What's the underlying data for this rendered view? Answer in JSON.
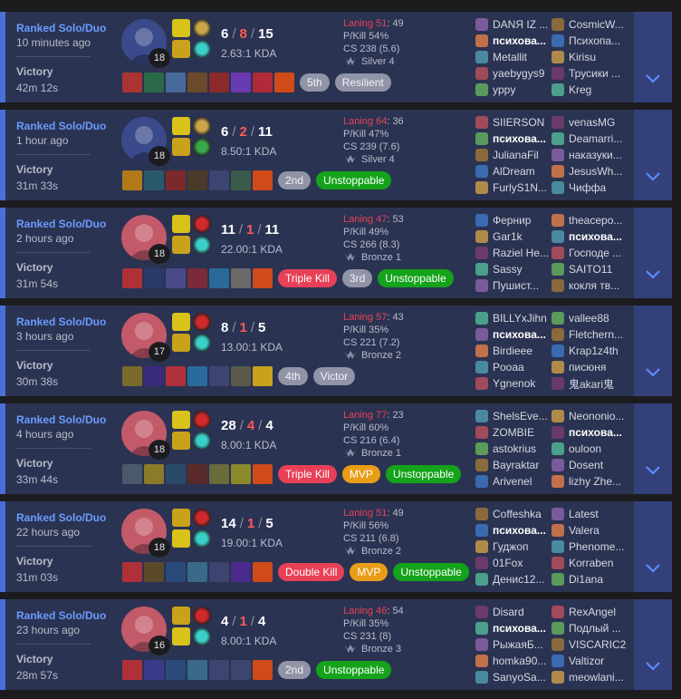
{
  "matches": [
    {
      "queue": "Ranked Solo/Duo",
      "time_ago": "10 minutes ago",
      "result": "Victory",
      "duration": "42m 12s",
      "champion_icon": "warwick-champion-icon",
      "champ_color": "#3a4a8a",
      "level": "18",
      "spells": [
        "flash-spell-icon",
        "smite-spell-icon"
      ],
      "spell_colors": [
        "#d9c21a",
        "#c8a21a"
      ],
      "runes": [
        "conqueror-rune-icon",
        "sorcery-rune-icon"
      ],
      "rune_colors": [
        "#c9a64a",
        "#3ad0c8"
      ],
      "kills": "6",
      "deaths": "8",
      "assists": "15",
      "kda_ratio": "2.63:1 KDA",
      "item_colors": [
        "#a33",
        "#2a6a4a",
        "#486a9a",
        "#6a4a2a",
        "#8a2a2a",
        "#6a3ab0",
        "#b02a3a",
        "#d04a1a"
      ],
      "badges": [
        {
          "text": "5th",
          "style": "place"
        },
        {
          "text": "Resilient",
          "style": "grey"
        }
      ],
      "laning_label": "Laning 51",
      "laning_opp": ": 49",
      "pkill": "P/Kill 54%",
      "cs": "CS 238 (5.6)",
      "rank": "Silver 4",
      "blue_team": [
        "DANЯ IZ ...",
        "психова...",
        "Metallit",
        "yaebygys9",
        "yppy"
      ],
      "red_team": [
        "CosmicW...",
        "Психопа...",
        "Kirisu",
        "Трусики ...",
        "Kreg"
      ],
      "me_index": 1
    },
    {
      "queue": "Ranked Solo/Duo",
      "time_ago": "1 hour ago",
      "result": "Victory",
      "duration": "31m 33s",
      "champion_icon": "warwick-champion-icon",
      "champ_color": "#3a4a8a",
      "level": "18",
      "spells": [
        "flash-spell-icon",
        "smite-spell-icon"
      ],
      "spell_colors": [
        "#d9c21a",
        "#c8a21a"
      ],
      "runes": [
        "conqueror-rune-icon",
        "resolve-rune-icon"
      ],
      "rune_colors": [
        "#c9a64a",
        "#3aa84a"
      ],
      "kills": "6",
      "deaths": "2",
      "assists": "11",
      "kda_ratio": "8.50:1 KDA",
      "item_colors": [
        "#b07a1a",
        "#2a5a6a",
        "#7a2a2a",
        "#4a3a2a",
        "empty",
        "#3a5a4a",
        "#d04a1a"
      ],
      "badges": [
        {
          "text": "2nd",
          "style": "place"
        },
        {
          "text": "Unstoppable",
          "style": "green"
        }
      ],
      "laning_label": "Laning 64",
      "laning_opp": ": 36",
      "pkill": "P/Kill 47%",
      "cs": "CS 239 (7.6)",
      "rank": "Silver 4",
      "blue_team": [
        "SIIERSON",
        "психова...",
        "JulianaFil",
        "AlDream",
        "FurlyS1N..."
      ],
      "red_team": [
        "venasMG",
        "Deamarri...",
        "наказуки...",
        "JesusWh...",
        "Чиффа"
      ],
      "me_index": 1
    },
    {
      "queue": "Ranked Solo/Duo",
      "time_ago": "2 hours ago",
      "result": "Victory",
      "duration": "31m 54s",
      "champion_icon": "vi-champion-icon",
      "champ_color": "#c25a6a",
      "level": "18",
      "spells": [
        "flash-spell-icon",
        "smite-spell-icon"
      ],
      "spell_colors": [
        "#d9c21a",
        "#c8a21a"
      ],
      "runes": [
        "electrocute-rune-icon",
        "sorcery-rune-icon"
      ],
      "rune_colors": [
        "#d02a2a",
        "#3ad0c8"
      ],
      "kills": "11",
      "deaths": "1",
      "assists": "11",
      "kda_ratio": "22.00:1 KDA",
      "item_colors": [
        "#b0303a",
        "#2a3a6a",
        "#4a4a8a",
        "#7a2a3a",
        "#2a6a9a",
        "#6a6a6a",
        "#d04a1a"
      ],
      "badges": [
        {
          "text": "Triple Kill",
          "style": "red"
        },
        {
          "text": "3rd",
          "style": "place"
        },
        {
          "text": "Unstoppable",
          "style": "green"
        }
      ],
      "laning_label": "Laning 47",
      "laning_opp": ": 53",
      "pkill": "P/Kill 49%",
      "cs": "CS 266 (8.3)",
      "rank": "Bronze 1",
      "blue_team": [
        "Фернир",
        "Gar1k",
        "Raziel He...",
        "Sassy",
        "Пушист..."
      ],
      "red_team": [
        "theacepo...",
        "психова...",
        "Господе ...",
        "SAITO11",
        "кокля тв..."
      ],
      "me_index": 6
    },
    {
      "queue": "Ranked Solo/Duo",
      "time_ago": "3 hours ago",
      "result": "Victory",
      "duration": "30m 38s",
      "champion_icon": "vi-champion-icon",
      "champ_color": "#c25a6a",
      "level": "17",
      "spells": [
        "flash-spell-icon",
        "smite-spell-icon"
      ],
      "spell_colors": [
        "#d9c21a",
        "#c8a21a"
      ],
      "runes": [
        "electrocute-rune-icon",
        "sorcery-rune-icon"
      ],
      "rune_colors": [
        "#d02a2a",
        "#3ad0c8"
      ],
      "kills": "8",
      "deaths": "1",
      "assists": "5",
      "kda_ratio": "13.00:1 KDA",
      "item_colors": [
        "#7a6a2a",
        "#3a2a7a",
        "#b0303a",
        "#2a6a9a",
        "empty",
        "#5a5a4a",
        "#c8a21a"
      ],
      "badges": [
        {
          "text": "4th",
          "style": "place"
        },
        {
          "text": "Victor",
          "style": "grey"
        }
      ],
      "laning_label": "Laning 57",
      "laning_opp": ": 43",
      "pkill": "P/Kill 35%",
      "cs": "CS 221 (7.2)",
      "rank": "Bronze 2",
      "blue_team": [
        "BILLYxJihn",
        "психова...",
        "Birdieee",
        "Pooaa",
        "Ygnenok"
      ],
      "red_team": [
        "vallee88",
        "Fletchern...",
        "Krap1z4th",
        "писюня",
        "鬼akari鬼"
      ],
      "me_index": 1
    },
    {
      "queue": "Ranked Solo/Duo",
      "time_ago": "4 hours ago",
      "result": "Victory",
      "duration": "33m 44s",
      "champion_icon": "vi-champion-icon",
      "champ_color": "#c25a6a",
      "level": "18",
      "spells": [
        "flash-spell-icon",
        "smite-spell-icon"
      ],
      "spell_colors": [
        "#d9c21a",
        "#c8a21a"
      ],
      "runes": [
        "electrocute-rune-icon",
        "sorcery-rune-icon"
      ],
      "rune_colors": [
        "#d02a2a",
        "#3ad0c8"
      ],
      "kills": "28",
      "deaths": "4",
      "assists": "4",
      "kda_ratio": "8.00:1 KDA",
      "item_colors": [
        "#4a5a6a",
        "#8a7a2a",
        "#2a4a6a",
        "#5a2a2a",
        "#6a6a3a",
        "#8a8a2a",
        "#d04a1a"
      ],
      "badges": [
        {
          "text": "Triple Kill",
          "style": "red"
        },
        {
          "text": "MVP",
          "style": "orange"
        },
        {
          "text": "Unstoppable",
          "style": "green"
        }
      ],
      "laning_label": "Laning 77",
      "laning_opp": ": 23",
      "pkill": "P/Kill 60%",
      "cs": "CS 216 (6.4)",
      "rank": "Bronze 1",
      "blue_team": [
        "ShelsEve...",
        "ZOMBIE",
        "astokrius",
        "Bayraktar",
        "Arivenel"
      ],
      "red_team": [
        "Neononio...",
        "психова...",
        "ouloon",
        "Dosent",
        "lizhy Zhe..."
      ],
      "me_index": 6
    },
    {
      "queue": "Ranked Solo/Duo",
      "time_ago": "22 hours ago",
      "result": "Victory",
      "duration": "31m 03s",
      "champion_icon": "vi-champion-icon",
      "champ_color": "#c25a6a",
      "level": "18",
      "spells": [
        "smite-spell-icon",
        "flash-spell-icon"
      ],
      "spell_colors": [
        "#c8a21a",
        "#d9c21a"
      ],
      "runes": [
        "electrocute-rune-icon",
        "sorcery-rune-icon"
      ],
      "rune_colors": [
        "#d02a2a",
        "#3ad0c8"
      ],
      "kills": "14",
      "deaths": "1",
      "assists": "5",
      "kda_ratio": "19.00:1 KDA",
      "item_colors": [
        "#b0303a",
        "#5a4a2a",
        "#2a4a7a",
        "#3a6a8a",
        "empty",
        "#4a2a8a",
        "#d04a1a"
      ],
      "badges": [
        {
          "text": "Double Kill",
          "style": "red"
        },
        {
          "text": "MVP",
          "style": "orange"
        },
        {
          "text": "Unstoppable",
          "style": "green"
        }
      ],
      "laning_label": "Laning 51",
      "laning_opp": ": 49",
      "pkill": "P/Kill 56%",
      "cs": "CS 211 (6.8)",
      "rank": "Bronze 2",
      "blue_team": [
        "Coffeshka",
        "психова...",
        "Гуджоп",
        "01Fox",
        "Денис12..."
      ],
      "red_team": [
        "Latest",
        "Valera",
        "Phenome...",
        "Korraben",
        "Di1ana"
      ],
      "me_index": 1
    },
    {
      "queue": "Ranked Solo/Duo",
      "time_ago": "23 hours ago",
      "result": "Victory",
      "duration": "28m 57s",
      "champion_icon": "vi-champion-icon",
      "champ_color": "#c25a6a",
      "level": "16",
      "spells": [
        "smite-spell-icon",
        "flash-spell-icon"
      ],
      "spell_colors": [
        "#c8a21a",
        "#d9c21a"
      ],
      "runes": [
        "electrocute-rune-icon",
        "sorcery-rune-icon"
      ],
      "rune_colors": [
        "#d02a2a",
        "#3ad0c8"
      ],
      "kills": "4",
      "deaths": "1",
      "assists": "4",
      "kda_ratio": "8.00:1 KDA",
      "item_colors": [
        "#b0303a",
        "#3a3a8a",
        "#2a4a7a",
        "#3a6a8a",
        "empty",
        "empty",
        "#d04a1a"
      ],
      "badges": [
        {
          "text": "2nd",
          "style": "place"
        },
        {
          "text": "Unstoppable",
          "style": "green"
        }
      ],
      "laning_label": "Laning 46",
      "laning_opp": ": 54",
      "pkill": "P/Kill 35%",
      "cs": "CS 231 (8)",
      "rank": "Bronze 3",
      "blue_team": [
        "Disard",
        "психова...",
        "РыжаяБ...",
        "homka90...",
        "SanyoSa..."
      ],
      "red_team": [
        "RexAngel",
        "Подлый ...",
        "VISCARIC2",
        "Valtizor",
        "meowlani..."
      ],
      "me_index": 1
    }
  ]
}
